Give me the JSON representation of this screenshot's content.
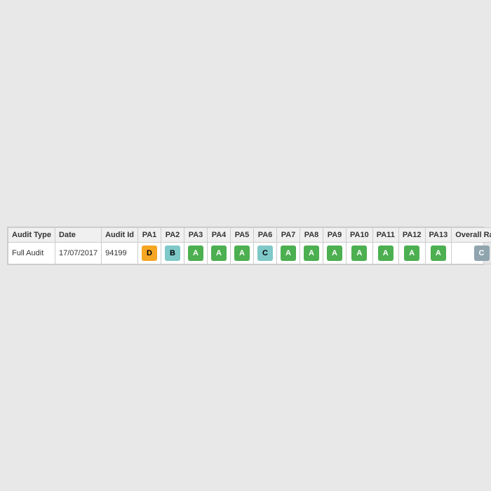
{
  "table": {
    "headers": [
      "Audit Type",
      "Date",
      "Audit Id",
      "PA1",
      "PA2",
      "PA3",
      "PA4",
      "PA5",
      "PA6",
      "PA7",
      "PA8",
      "PA9",
      "PA10",
      "PA11",
      "PA12",
      "PA13",
      "Overall Rating"
    ],
    "rows": [
      {
        "audit_type": "Full Audit",
        "date": "17/07/2017",
        "audit_id": "94199",
        "pa1": {
          "label": "D",
          "color": "orange"
        },
        "pa2": {
          "label": "B",
          "color": "blue-light"
        },
        "pa3": {
          "label": "A",
          "color": "green"
        },
        "pa4": {
          "label": "A",
          "color": "green"
        },
        "pa5": {
          "label": "A",
          "color": "green"
        },
        "pa6": {
          "label": "C",
          "color": "blue-light"
        },
        "pa7": {
          "label": "A",
          "color": "green"
        },
        "pa8": {
          "label": "A",
          "color": "green"
        },
        "pa9": {
          "label": "A",
          "color": "green"
        },
        "pa10": {
          "label": "A",
          "color": "green"
        },
        "pa11": {
          "label": "A",
          "color": "green"
        },
        "pa12": {
          "label": "A",
          "color": "green"
        },
        "pa13": {
          "label": "A",
          "color": "green"
        },
        "overall_rating": {
          "label": "C",
          "color": "grey-blue"
        }
      }
    ]
  }
}
